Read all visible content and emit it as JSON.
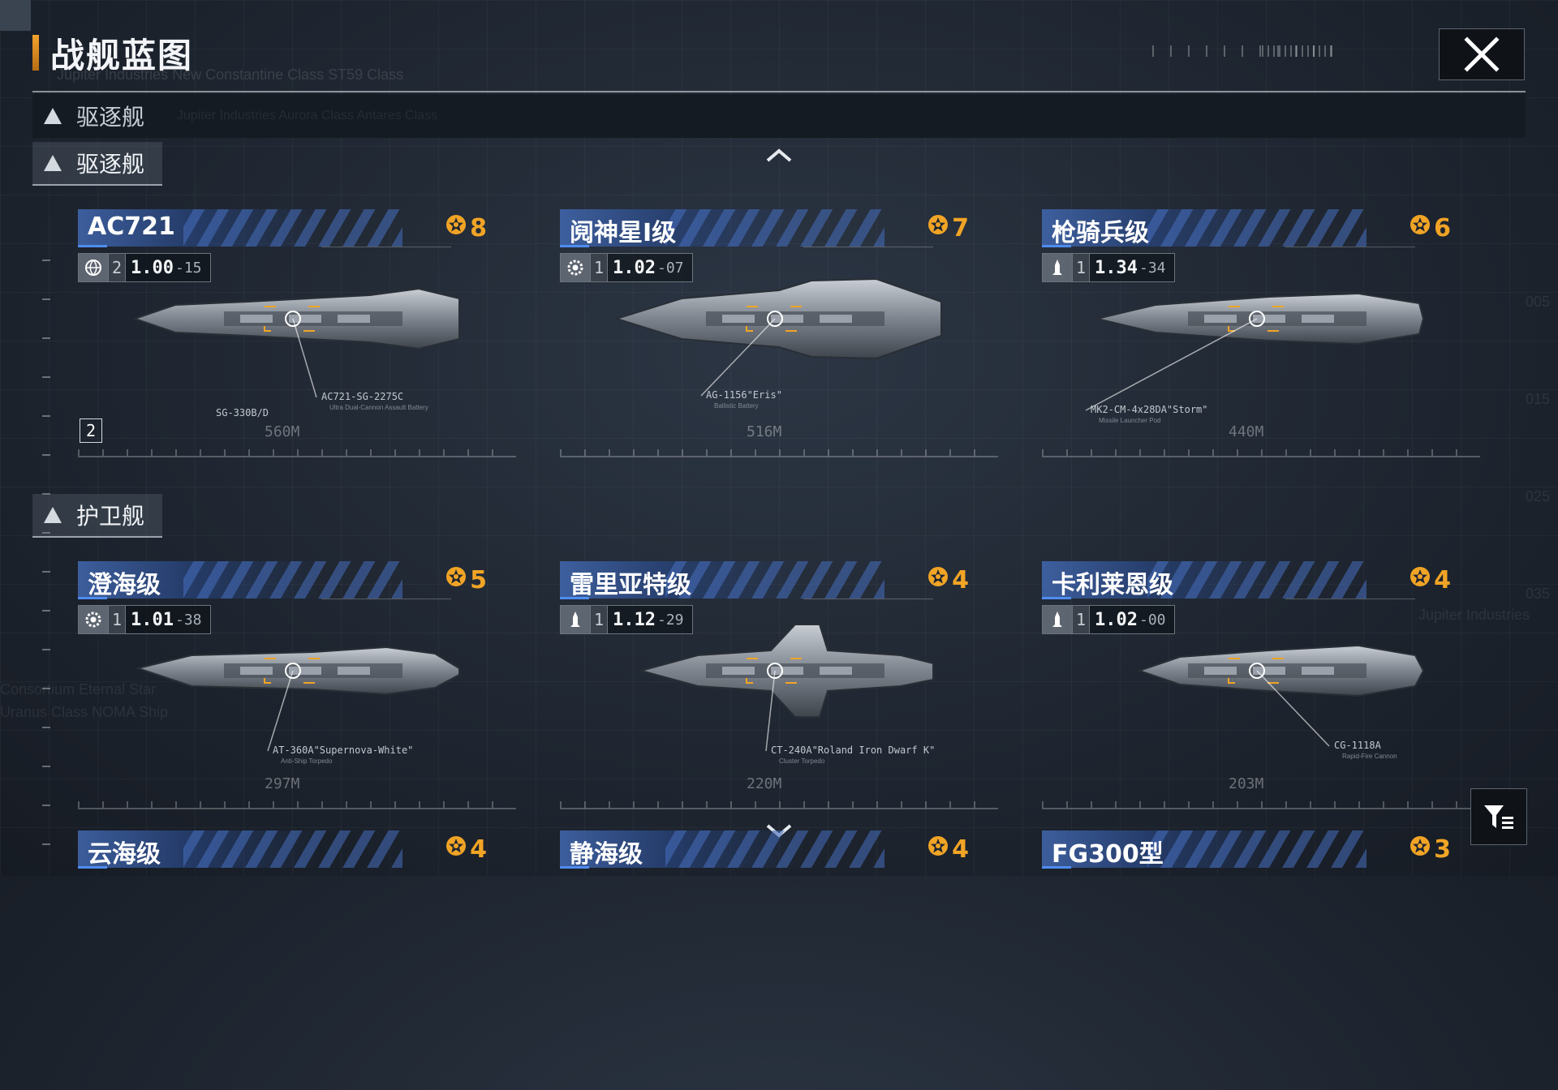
{
  "header": {
    "title": "战舰蓝图",
    "subtitle_watermark": "Jupiter Industries  New Constantine Class  ST59 Class",
    "close_icon": "close-x-icon"
  },
  "category_bar": {
    "label": "驱逐舰",
    "watermark": "Jupiter Industries  Aurora Class  Antares Class"
  },
  "sections": [
    {
      "label": "驱逐舰"
    },
    {
      "label": "护卫舰"
    }
  ],
  "ships": [
    {
      "name": "AC721",
      "rank": "8",
      "stat_icon": "globe-icon",
      "tier": "2",
      "version": "1.00",
      "version_sub": "-15",
      "weapon": "AC721-SG-2275C",
      "weapon_desc": "Ultra Dual-Cannon Assault Battery",
      "weapon2": "SG-330B/D",
      "length": "560M",
      "count": "2"
    },
    {
      "name": "阋神星I级",
      "rank": "7",
      "stat_icon": "gear-icon",
      "tier": "1",
      "version": "1.02",
      "version_sub": "-07",
      "weapon": "AG-1156\"Eris\"",
      "weapon_desc": "Ballistic Battery",
      "length": "516M"
    },
    {
      "name": "枪骑兵级",
      "rank": "6",
      "stat_icon": "rocket-icon",
      "tier": "1",
      "version": "1.34",
      "version_sub": "-34",
      "weapon": "MK2-CM-4x28DA\"Storm\"",
      "weapon_desc": "Missile Launcher Pod",
      "length": "440M"
    },
    {
      "name": "澄海级",
      "rank": "5",
      "stat_icon": "gear-icon",
      "tier": "1",
      "version": "1.01",
      "version_sub": "-38",
      "weapon": "AT-360A\"Supernova-White\"",
      "weapon_desc": "Anti-Ship Torpedo",
      "length": "297M"
    },
    {
      "name": "雷里亚特级",
      "rank": "4",
      "stat_icon": "rocket-icon",
      "tier": "1",
      "version": "1.12",
      "version_sub": "-29",
      "weapon": "CT-240A\"Roland Iron Dwarf K\"",
      "weapon_desc": "Cluster Torpedo",
      "length": "220M"
    },
    {
      "name": "卡利莱恩级",
      "rank": "4",
      "stat_icon": "rocket-icon",
      "tier": "1",
      "version": "1.02",
      "version_sub": "-00",
      "weapon": "CG-1118A",
      "weapon_desc": "Rapid-Fire Cannon",
      "length": "203M"
    },
    {
      "name": "云海级",
      "rank": "4"
    },
    {
      "name": "静海级",
      "rank": "4"
    },
    {
      "name": "FG300型",
      "rank": "3"
    }
  ],
  "background_labels": [
    "005",
    "015",
    "025",
    "035",
    "Jupiter Industries",
    "Consortium Eternal Star",
    "Uranus Class NOMA Ship"
  ],
  "colors": {
    "accent_orange": "#f1a425",
    "title_blue": "#4268b0",
    "panel_dark": "#151b22"
  }
}
